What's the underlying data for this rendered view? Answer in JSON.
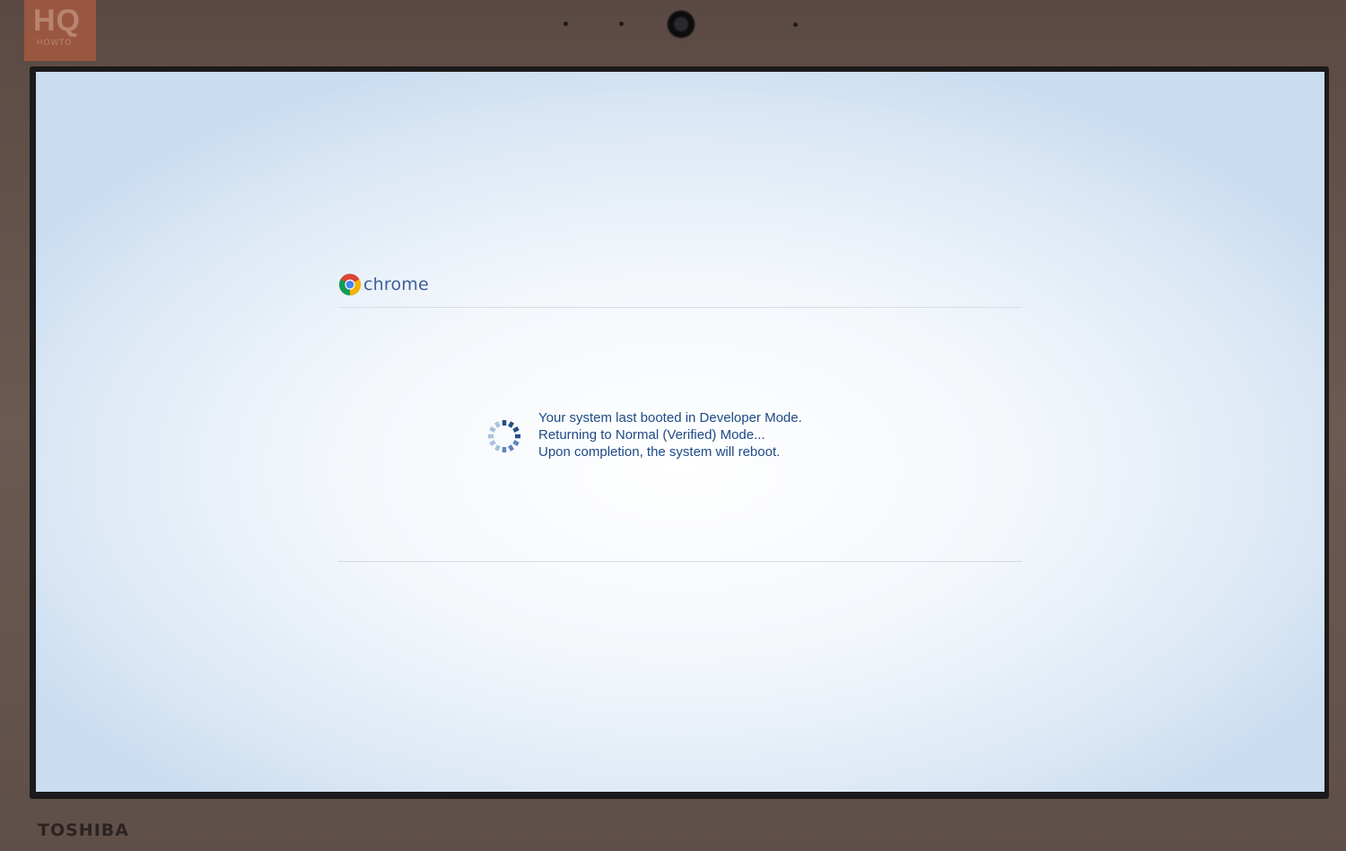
{
  "watermark": {
    "text": "HQ",
    "subtext": "HOWTO"
  },
  "header": {
    "product_name": "chrome",
    "logo_icon": "chrome-logo-icon"
  },
  "status": {
    "spinner_icon": "loading-spinner-icon",
    "lines": [
      "Your system last booted in Developer Mode.",
      "Returning to Normal (Verified) Mode...",
      "Upon completion, the system will reboot."
    ]
  },
  "device": {
    "brand": "TOSHIBA"
  },
  "colors": {
    "text_accent": "#1d4a86",
    "chrome_word": "#3d5f95",
    "screen_bg": "#eef4fa",
    "bezel": "#5f4f49"
  }
}
